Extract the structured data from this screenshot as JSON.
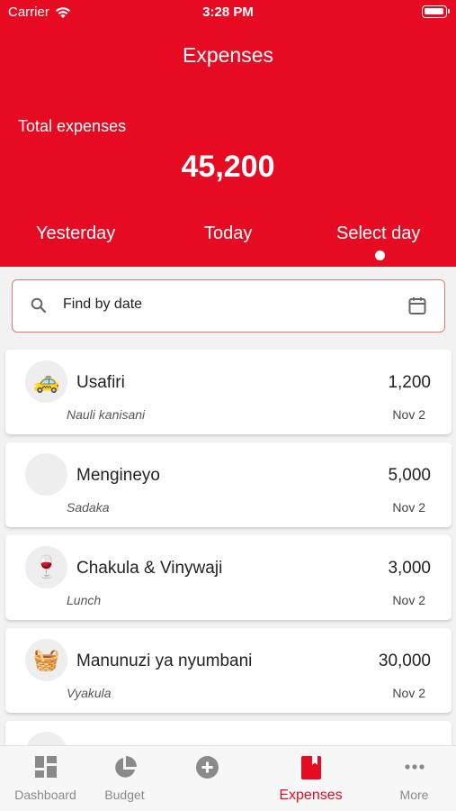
{
  "status_bar": {
    "carrier": "Carrier",
    "time": "3:28 PM"
  },
  "header": {
    "title": "Expenses",
    "total_label": "Total expenses",
    "total_value": "45,200",
    "tabs": [
      {
        "label": "Yesterday",
        "selected": false
      },
      {
        "label": "Today",
        "selected": false
      },
      {
        "label": "Select day",
        "selected": true
      }
    ]
  },
  "search": {
    "placeholder": "Find by date",
    "value": ""
  },
  "expenses": [
    {
      "category": "Usafiri",
      "note": "Nauli kanisani",
      "amount": "1,200",
      "date": "Nov 2",
      "icon": "taxi-icon"
    },
    {
      "category": "Mengineyo",
      "note": "Sadaka",
      "amount": "5,000",
      "date": "Nov 2",
      "icon": "blank-icon"
    },
    {
      "category": "Chakula & Vinywaji",
      "note": "Lunch",
      "amount": "3,000",
      "date": "Nov 2",
      "icon": "food-drink-icon"
    },
    {
      "category": "Manunuzi ya nyumbani",
      "note": "Vyakula",
      "amount": "30,000",
      "date": "Nov 2",
      "icon": "shopping-basket-icon"
    }
  ],
  "tabbar": {
    "items": [
      {
        "label": "Dashboard",
        "icon": "dashboard-icon"
      },
      {
        "label": "Budget",
        "icon": "pie-chart-icon"
      },
      {
        "label": "",
        "icon": "add-circle-icon"
      },
      {
        "label": "Expenses",
        "icon": "book-icon",
        "active": true
      },
      {
        "label": "More",
        "icon": "more-dots-icon"
      }
    ]
  },
  "colors": {
    "brand_red": "#e60b22",
    "search_border": "#e7776f",
    "inactive_tab": "#8a8a8a"
  }
}
